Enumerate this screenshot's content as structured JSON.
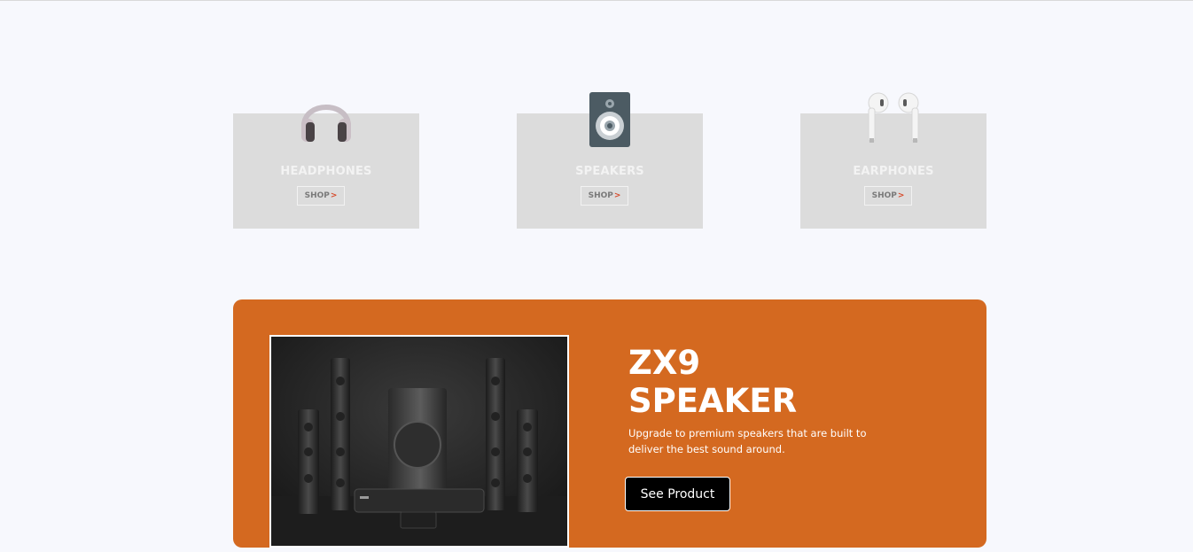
{
  "categories": [
    {
      "title": "HEADPHONES",
      "shop_label": "SHOP",
      "arrow": ">",
      "icon": "headphones-icon"
    },
    {
      "title": "SPEAKERS",
      "shop_label": "SHOP",
      "arrow": ">",
      "icon": "speaker-icon"
    },
    {
      "title": "EARPHONES",
      "shop_label": "SHOP",
      "arrow": ">",
      "icon": "earphones-icon"
    }
  ],
  "promo": {
    "title_line1": "ZX9",
    "title_line2": "SPEAKER",
    "description": "Upgrade to premium speakers that are built to deliver the best sound around.",
    "cta_label": "See Product",
    "image": "speaker-system-image"
  },
  "colors": {
    "page_background": "#f7f8fd",
    "card_background": "#dcdcdc",
    "promo_background": "#d46920",
    "shop_arrow": "#d64a2b",
    "cta_background": "#000000"
  }
}
